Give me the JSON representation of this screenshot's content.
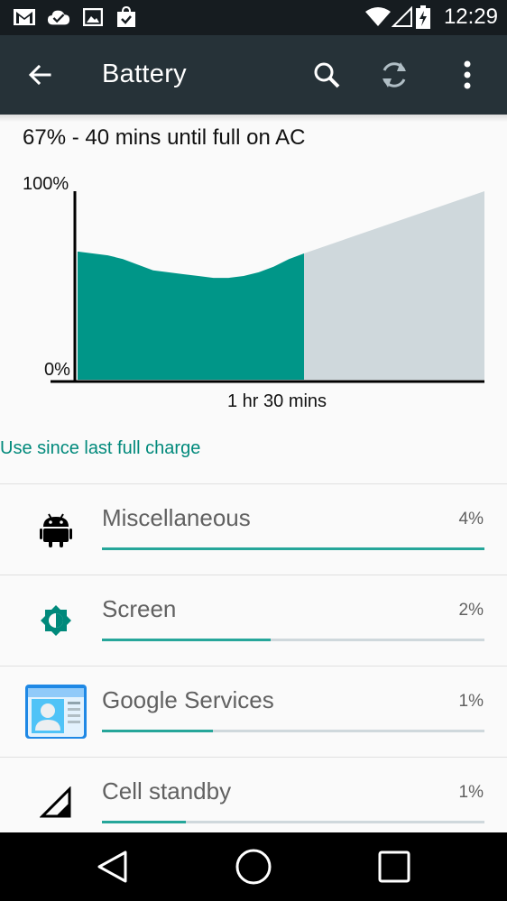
{
  "status_bar": {
    "left_icons": [
      "gmail-icon",
      "tasks-done-icon",
      "gallery-icon",
      "shopping-bag-icon"
    ],
    "right_icons": [
      "wifi-icon",
      "cell-signal-icon",
      "battery-charging-icon"
    ],
    "time": "12:29"
  },
  "app_bar": {
    "title": "Battery",
    "back_icon": "arrow-left-icon",
    "actions": [
      "search-icon",
      "refresh-icon",
      "overflow-menu-icon"
    ]
  },
  "summary": "67% - 40 mins until full on AC",
  "chart_data": {
    "type": "area",
    "y_max_label": "100%",
    "y_min_label": "0%",
    "x_label": "1 hr 30 mins",
    "ylim": [
      0,
      100
    ],
    "history": {
      "color": "#009688",
      "values": [
        68,
        67,
        66,
        64,
        61,
        58,
        57,
        56,
        55,
        54,
        54,
        55,
        57,
        60,
        64,
        67
      ]
    },
    "projection": {
      "color": "#cfd8dc",
      "start": 67,
      "end": 100
    }
  },
  "section_header": "Use since last full charge",
  "usage": [
    {
      "name": "Miscellaneous",
      "percent": "4%",
      "fraction": 1.0,
      "icon": "android-icon"
    },
    {
      "name": "Screen",
      "percent": "2%",
      "fraction": 0.44,
      "icon": "brightness-icon"
    },
    {
      "name": "Google Services",
      "percent": "1%",
      "fraction": 0.29,
      "icon": "contacts-card-icon"
    },
    {
      "name": "Cell standby",
      "percent": "1%",
      "fraction": 0.22,
      "icon": "cell-signal-icon"
    }
  ],
  "nav_bar": [
    "back-triangle-icon",
    "home-circle-icon",
    "recents-square-icon"
  ],
  "colors": {
    "accent": "#009688",
    "appbar": "#263238",
    "statusbar": "#161c20"
  }
}
